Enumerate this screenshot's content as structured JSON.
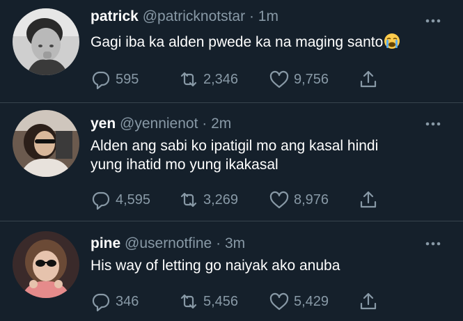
{
  "tweets": [
    {
      "name": "patrick",
      "handle": "@patricknotstar",
      "separator": "·",
      "time": "1m",
      "text_lines": [
        "Gagi iba ka alden pwede ka na maging santo"
      ],
      "emoji": "loudly-crying-face",
      "replies": "595",
      "retweets": "2,346",
      "likes": "9,756"
    },
    {
      "name": "yen",
      "handle": "@yennienot",
      "separator": "·",
      "time": "2m",
      "text_lines": [
        "Alden ang sabi ko ipatigil mo ang kasal hindi",
        "yung ihatid mo yung ikakasal"
      ],
      "replies": "4,595",
      "retweets": "3,269",
      "likes": "8,976"
    },
    {
      "name": "pine",
      "handle": "@usernotfine",
      "separator": "·",
      "time": "3m",
      "text_lines": [
        "His way of letting go naiyak ako anuba"
      ],
      "replies": "346",
      "retweets": "5,456",
      "likes": "5,429"
    }
  ],
  "colors": {
    "background": "#15202b",
    "secondary_text": "#8899a6",
    "divider": "#38444d"
  },
  "icons": [
    "reply-icon",
    "retweet-icon",
    "like-icon",
    "share-icon",
    "more-icon"
  ]
}
